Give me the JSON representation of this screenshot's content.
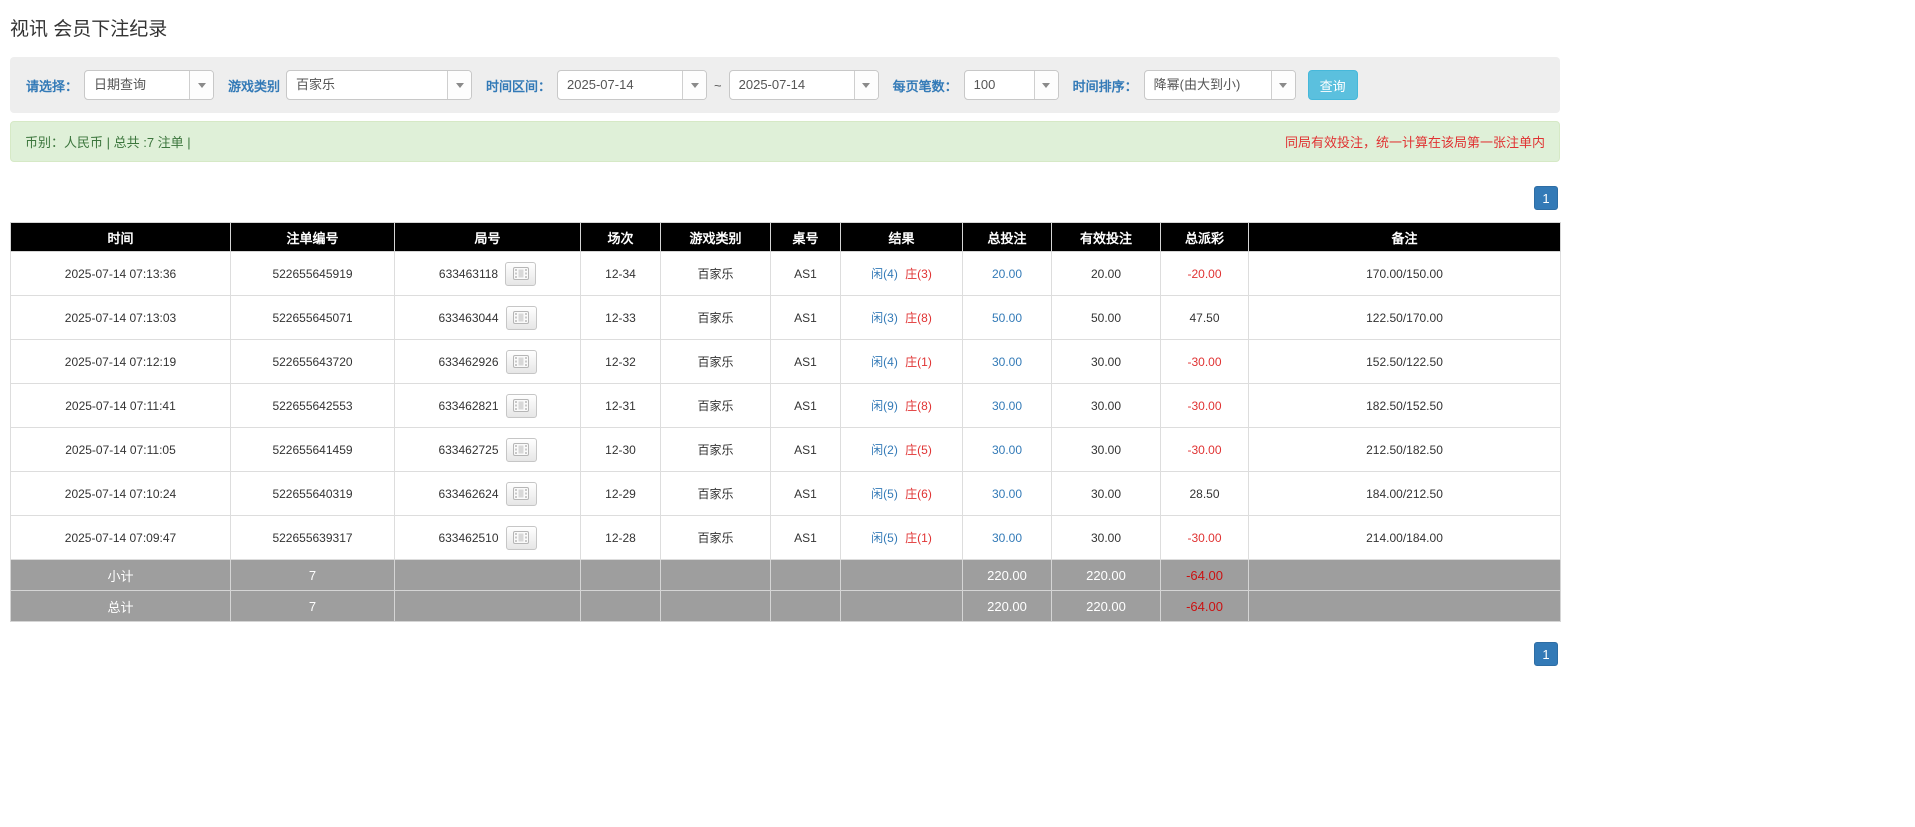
{
  "page": {
    "title": "视讯 会员下注纪录"
  },
  "filters": {
    "select_label": "请选择：",
    "select_value": "日期查询",
    "game_type_label": "游戏类别",
    "game_type_value": "百家乐",
    "date_range_label": "时间区间：",
    "date_from": "2025-07-14",
    "date_separator": "~",
    "date_to": "2025-07-14",
    "page_size_label": "每页笔数：",
    "page_size_value": "100",
    "sort_label": "时间排序：",
    "sort_value": "降幂(由大到小)",
    "search_button": "查询"
  },
  "notice": {
    "summary": "币别：人民币 | 总共 :7 注单 |",
    "warning": "同局有效投注，统一计算在该局第一张注单内"
  },
  "pagination": {
    "current_page": "1"
  },
  "icons": {
    "dropdown": "chevron-down-icon",
    "round_replay": "video-icon"
  },
  "colors": {
    "accent_blue": "#337ab7",
    "red": "#e03333",
    "header_bg": "#000000",
    "summary_row_bg": "#9e9e9e",
    "notice_bg": "#dff0d8",
    "search_button_bg": "#5bc0de"
  },
  "table": {
    "headers": {
      "time": "时间",
      "bet_id": "注单编号",
      "round_id": "局号",
      "session": "场次",
      "game": "游戏类别",
      "table_no": "桌号",
      "result": "结果",
      "total_bet": "总投注",
      "valid_bet": "有效投注",
      "payout": "总派彩",
      "remark": "备注"
    },
    "rows": [
      {
        "time": "2025-07-14 07:13:36",
        "bet_id": "522655645919",
        "round_id": "633463118",
        "session": "12-34",
        "game": "百家乐",
        "table_no": "AS1",
        "result_player": "闲(4)",
        "result_banker": "庄(3)",
        "total_bet": "20.00",
        "valid_bet": "20.00",
        "payout": "-20.00",
        "remark": "170.00/150.00"
      },
      {
        "time": "2025-07-14 07:13:03",
        "bet_id": "522655645071",
        "round_id": "633463044",
        "session": "12-33",
        "game": "百家乐",
        "table_no": "AS1",
        "result_player": "闲(3)",
        "result_banker": "庄(8)",
        "total_bet": "50.00",
        "valid_bet": "50.00",
        "payout": "47.50",
        "remark": "122.50/170.00"
      },
      {
        "time": "2025-07-14 07:12:19",
        "bet_id": "522655643720",
        "round_id": "633462926",
        "session": "12-32",
        "game": "百家乐",
        "table_no": "AS1",
        "result_player": "闲(4)",
        "result_banker": "庄(1)",
        "total_bet": "30.00",
        "valid_bet": "30.00",
        "payout": "-30.00",
        "remark": "152.50/122.50"
      },
      {
        "time": "2025-07-14 07:11:41",
        "bet_id": "522655642553",
        "round_id": "633462821",
        "session": "12-31",
        "game": "百家乐",
        "table_no": "AS1",
        "result_player": "闲(9)",
        "result_banker": "庄(8)",
        "total_bet": "30.00",
        "valid_bet": "30.00",
        "payout": "-30.00",
        "remark": "182.50/152.50"
      },
      {
        "time": "2025-07-14 07:11:05",
        "bet_id": "522655641459",
        "round_id": "633462725",
        "session": "12-30",
        "game": "百家乐",
        "table_no": "AS1",
        "result_player": "闲(2)",
        "result_banker": "庄(5)",
        "total_bet": "30.00",
        "valid_bet": "30.00",
        "payout": "-30.00",
        "remark": "212.50/182.50"
      },
      {
        "time": "2025-07-14 07:10:24",
        "bet_id": "522655640319",
        "round_id": "633462624",
        "session": "12-29",
        "game": "百家乐",
        "table_no": "AS1",
        "result_player": "闲(5)",
        "result_banker": "庄(6)",
        "total_bet": "30.00",
        "valid_bet": "30.00",
        "payout": "28.50",
        "remark": "184.00/212.50"
      },
      {
        "time": "2025-07-14 07:09:47",
        "bet_id": "522655639317",
        "round_id": "633462510",
        "session": "12-28",
        "game": "百家乐",
        "table_no": "AS1",
        "result_player": "闲(5)",
        "result_banker": "庄(1)",
        "total_bet": "30.00",
        "valid_bet": "30.00",
        "payout": "-30.00",
        "remark": "214.00/184.00"
      }
    ],
    "subtotal": {
      "label": "小计",
      "count": "7",
      "total_bet": "220.00",
      "valid_bet": "220.00",
      "payout": "-64.00"
    },
    "total": {
      "label": "总计",
      "count": "7",
      "total_bet": "220.00",
      "valid_bet": "220.00",
      "payout": "-64.00"
    }
  }
}
